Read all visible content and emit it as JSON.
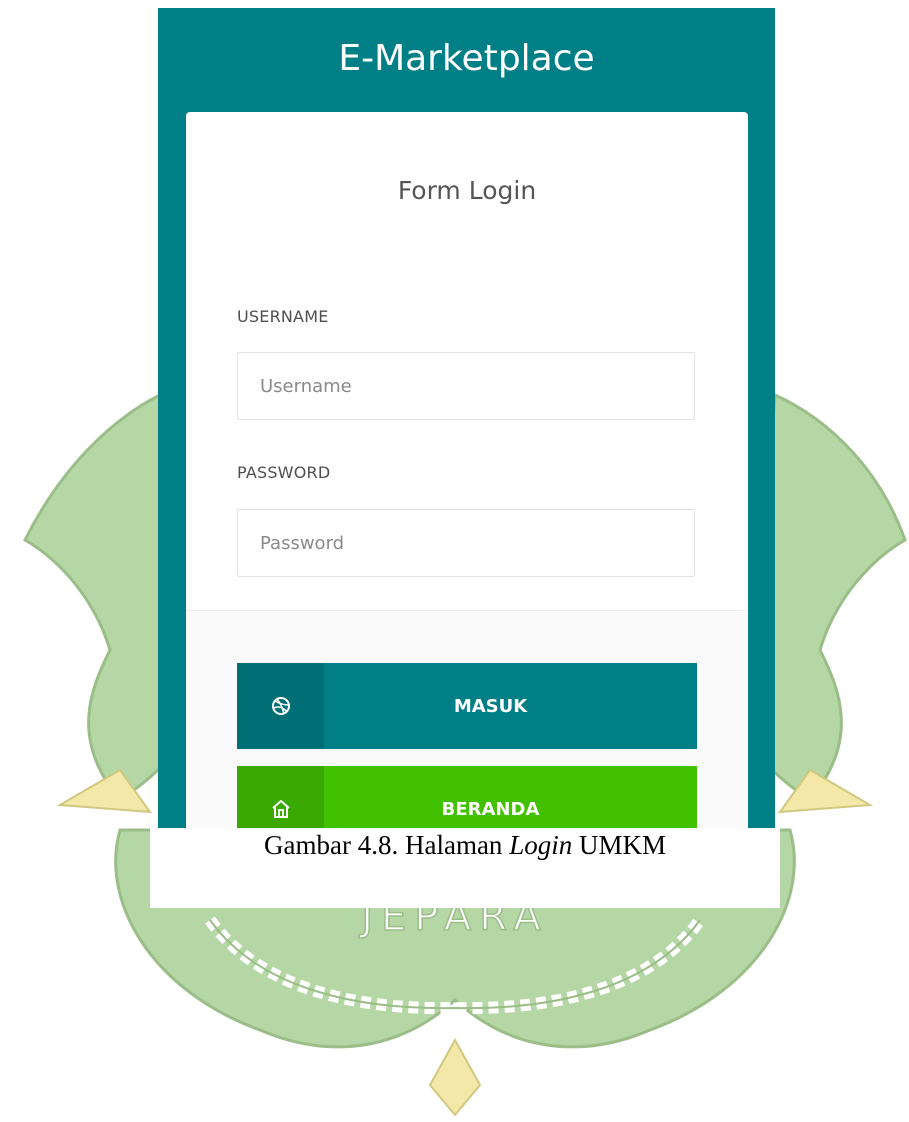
{
  "app": {
    "title": "E-Marketplace",
    "colors": {
      "primary": "#007f87",
      "success": "#42c100"
    }
  },
  "form": {
    "title": "Form Login",
    "username": {
      "label": "USERNAME",
      "placeholder": "Username",
      "value": ""
    },
    "password": {
      "label": "PASSWORD",
      "placeholder": "Password",
      "value": ""
    },
    "buttons": {
      "masuk": {
        "label": "MASUK",
        "icon": "dribbble-icon"
      },
      "beranda": {
        "label": "BERANDA",
        "icon": "home-icon"
      }
    }
  },
  "caption": {
    "prefix": "Gambar 4.8. Halaman ",
    "emphasis": "Login",
    "suffix": " UMKM"
  },
  "watermark": {
    "text": "JEPARA",
    "colors": {
      "green": "#9fc98a",
      "yellow": "#f1e59a"
    }
  }
}
